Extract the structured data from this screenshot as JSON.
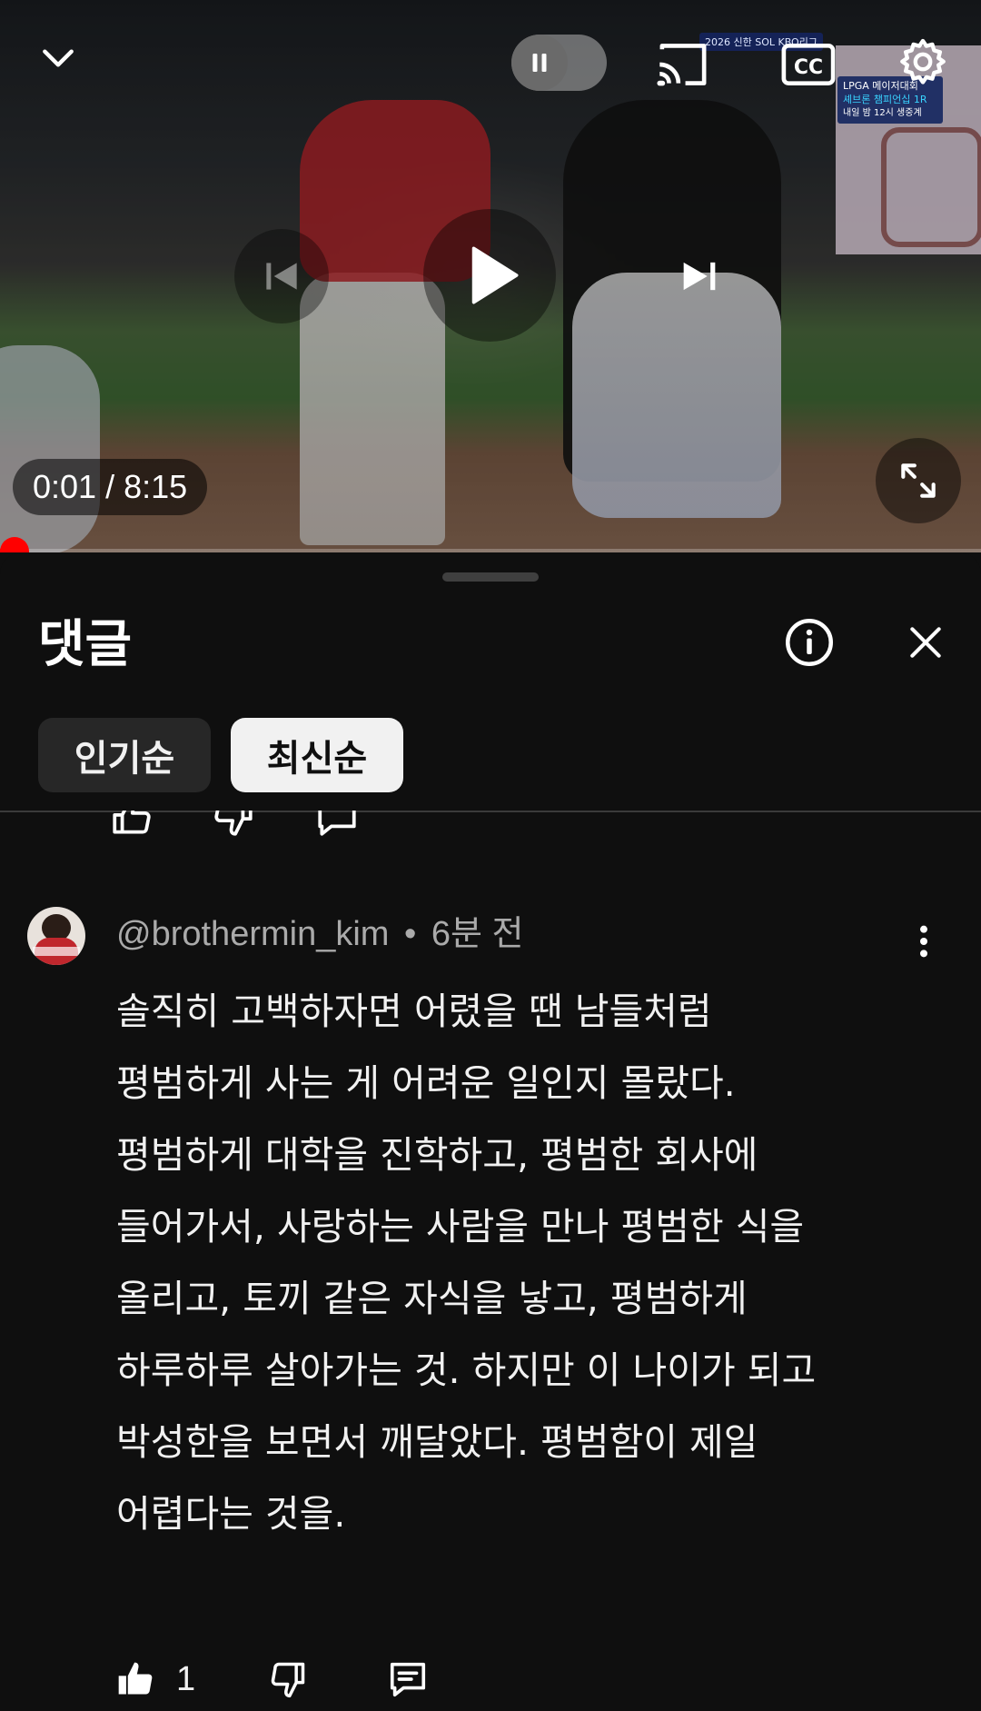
{
  "player": {
    "time_current": "0:01",
    "time_separator": " / ",
    "time_total": "8:15",
    "progress": 0.002,
    "broadcast": {
      "tag": "2026 신한 SOL KBO리그",
      "box_line1": "LPGA 메이저대회",
      "box_line2": "셰브론 챔피언십 1R",
      "box_line3": "내일 밤 12시 생중계"
    },
    "icons": {
      "collapse": "chevron-down-icon",
      "autoplay": "pause-icon",
      "cast": "cast-icon",
      "captions": "cc-icon",
      "settings": "gear-icon",
      "previous": "skip-previous-icon",
      "play": "play-icon",
      "next": "skip-next-icon",
      "fullscreen": "fullscreen-icon"
    }
  },
  "comments_panel": {
    "title": "댓글",
    "sort_chips": [
      {
        "label": "인기순",
        "selected": false
      },
      {
        "label": "최신순",
        "selected": true
      }
    ],
    "comment": {
      "author": "@brothermin_kim",
      "separator": "•",
      "time": "6분 전",
      "text": "솔직히 고백하자면 어렸을 땐 남들처럼\n평범하게 사는 게 어려운 일인지 몰랐다.\n평범하게 대학을 진학하고, 평범한 회사에\n들어가서, 사랑하는 사람을 만나 평범한 식을\n올리고, 토끼 같은 자식을 낳고, 평범하게\n하루하루 살아가는 것. 하지만 이 나이가 되고\n박성한을 보면서 깨달았다. 평범함이 제일\n어렵다는 것을.",
      "like_count": "1"
    }
  },
  "colors": {
    "background": "#0f0f0f",
    "progress": "#ff0000",
    "chip_active_bg": "#f1f1f1",
    "chip_inactive_bg": "#272727",
    "secondary_text": "#aaaaaa"
  }
}
